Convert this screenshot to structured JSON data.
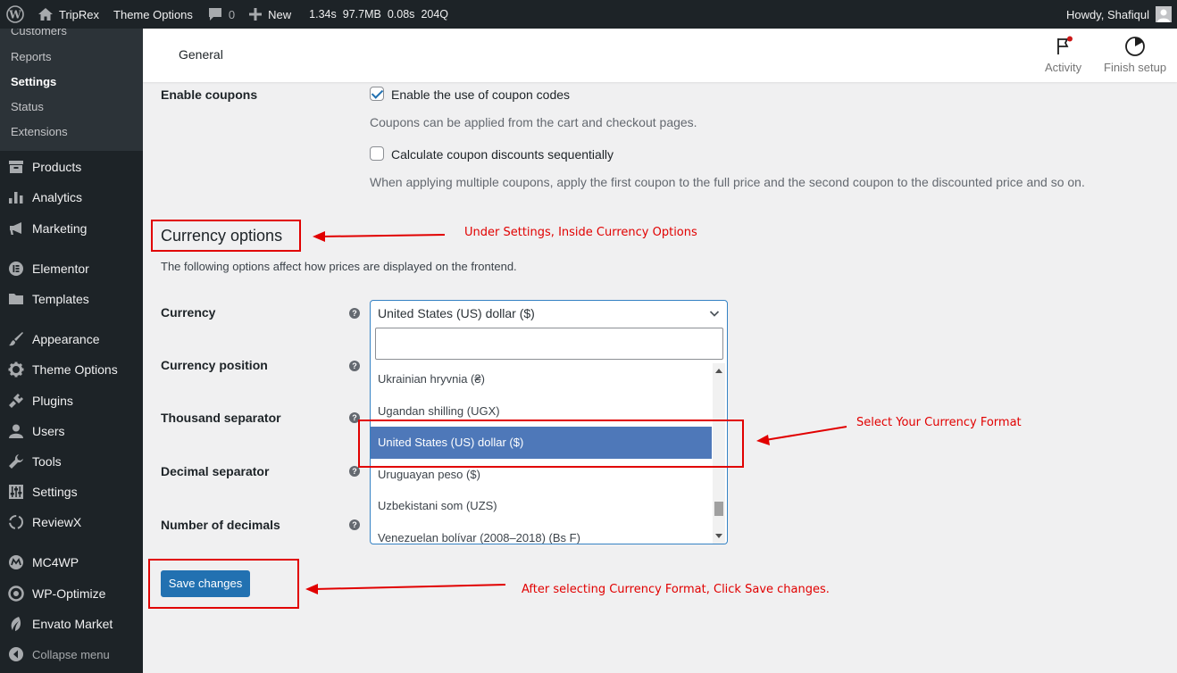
{
  "admin_bar": {
    "site_name": "TripRex",
    "theme_options": "Theme Options",
    "comments_count": "0",
    "new_label": "New",
    "perf": [
      "1.34s",
      "97.7MB",
      "0.08s",
      "204Q"
    ],
    "greeting": "Howdy, Shafiqul"
  },
  "sidebar": {
    "submenu": [
      {
        "label": "Customers"
      },
      {
        "label": "Reports"
      },
      {
        "label": "Settings"
      },
      {
        "label": "Status"
      },
      {
        "label": "Extensions"
      }
    ],
    "items": [
      {
        "label": "Products",
        "icon": "archive-icon"
      },
      {
        "label": "Analytics",
        "icon": "bar-chart-icon"
      },
      {
        "label": "Marketing",
        "icon": "megaphone-icon"
      },
      {
        "label": "Elementor",
        "icon": "elementor-icon"
      },
      {
        "label": "Templates",
        "icon": "folder-icon"
      },
      {
        "label": "Appearance",
        "icon": "paintbrush-icon"
      },
      {
        "label": "Theme Options",
        "icon": "gear-icon"
      },
      {
        "label": "Plugins",
        "icon": "plug-icon"
      },
      {
        "label": "Users",
        "icon": "user-icon"
      },
      {
        "label": "Tools",
        "icon": "wrench-icon"
      },
      {
        "label": "Settings",
        "icon": "sliders-icon"
      },
      {
        "label": "ReviewX",
        "icon": "dashed-circle-icon"
      },
      {
        "label": "MC4WP",
        "icon": "mc4wp-icon"
      },
      {
        "label": "WP-Optimize",
        "icon": "optimize-icon"
      },
      {
        "label": "Envato Market",
        "icon": "leaf-icon"
      }
    ],
    "collapse": "Collapse menu"
  },
  "header": {
    "title": "General",
    "activity": "Activity",
    "finish_setup": "Finish setup"
  },
  "coupons": {
    "label": "Enable coupons",
    "enable_text": "Enable the use of coupon codes",
    "enable_checked": true,
    "enable_desc": "Coupons can be applied from the cart and checkout pages.",
    "sequential_text": "Calculate coupon discounts sequentially",
    "sequential_checked": false,
    "sequential_desc": "When applying multiple coupons, apply the first coupon to the full price and the second coupon to the discounted price and so on."
  },
  "currency_section": {
    "heading": "Currency options",
    "intro": "The following options affect how prices are displayed on the frontend.",
    "labels": {
      "currency": "Currency",
      "position": "Currency position",
      "thousand": "Thousand separator",
      "decimal": "Decimal separator",
      "decimals": "Number of decimals"
    },
    "help_glyph": "?",
    "selected_value": "United States (US) dollar ($)",
    "search_value": "",
    "options": [
      "Ukrainian hryvnia (₴)",
      "Ugandan shilling (UGX)",
      "United States (US) dollar ($)",
      "Uruguayan peso ($)",
      "Uzbekistani som (UZS)",
      "Venezuelan bolívar (2008–2018) (Bs F)"
    ],
    "highlighted_index": 2
  },
  "save_button": "Save changes",
  "annotations": {
    "a1": "Under Settings, Inside Currency Options",
    "a2": "Select Your Currency Format",
    "a3": "After selecting Currency Format, Click Save changes.",
    "color": "#e10000"
  }
}
